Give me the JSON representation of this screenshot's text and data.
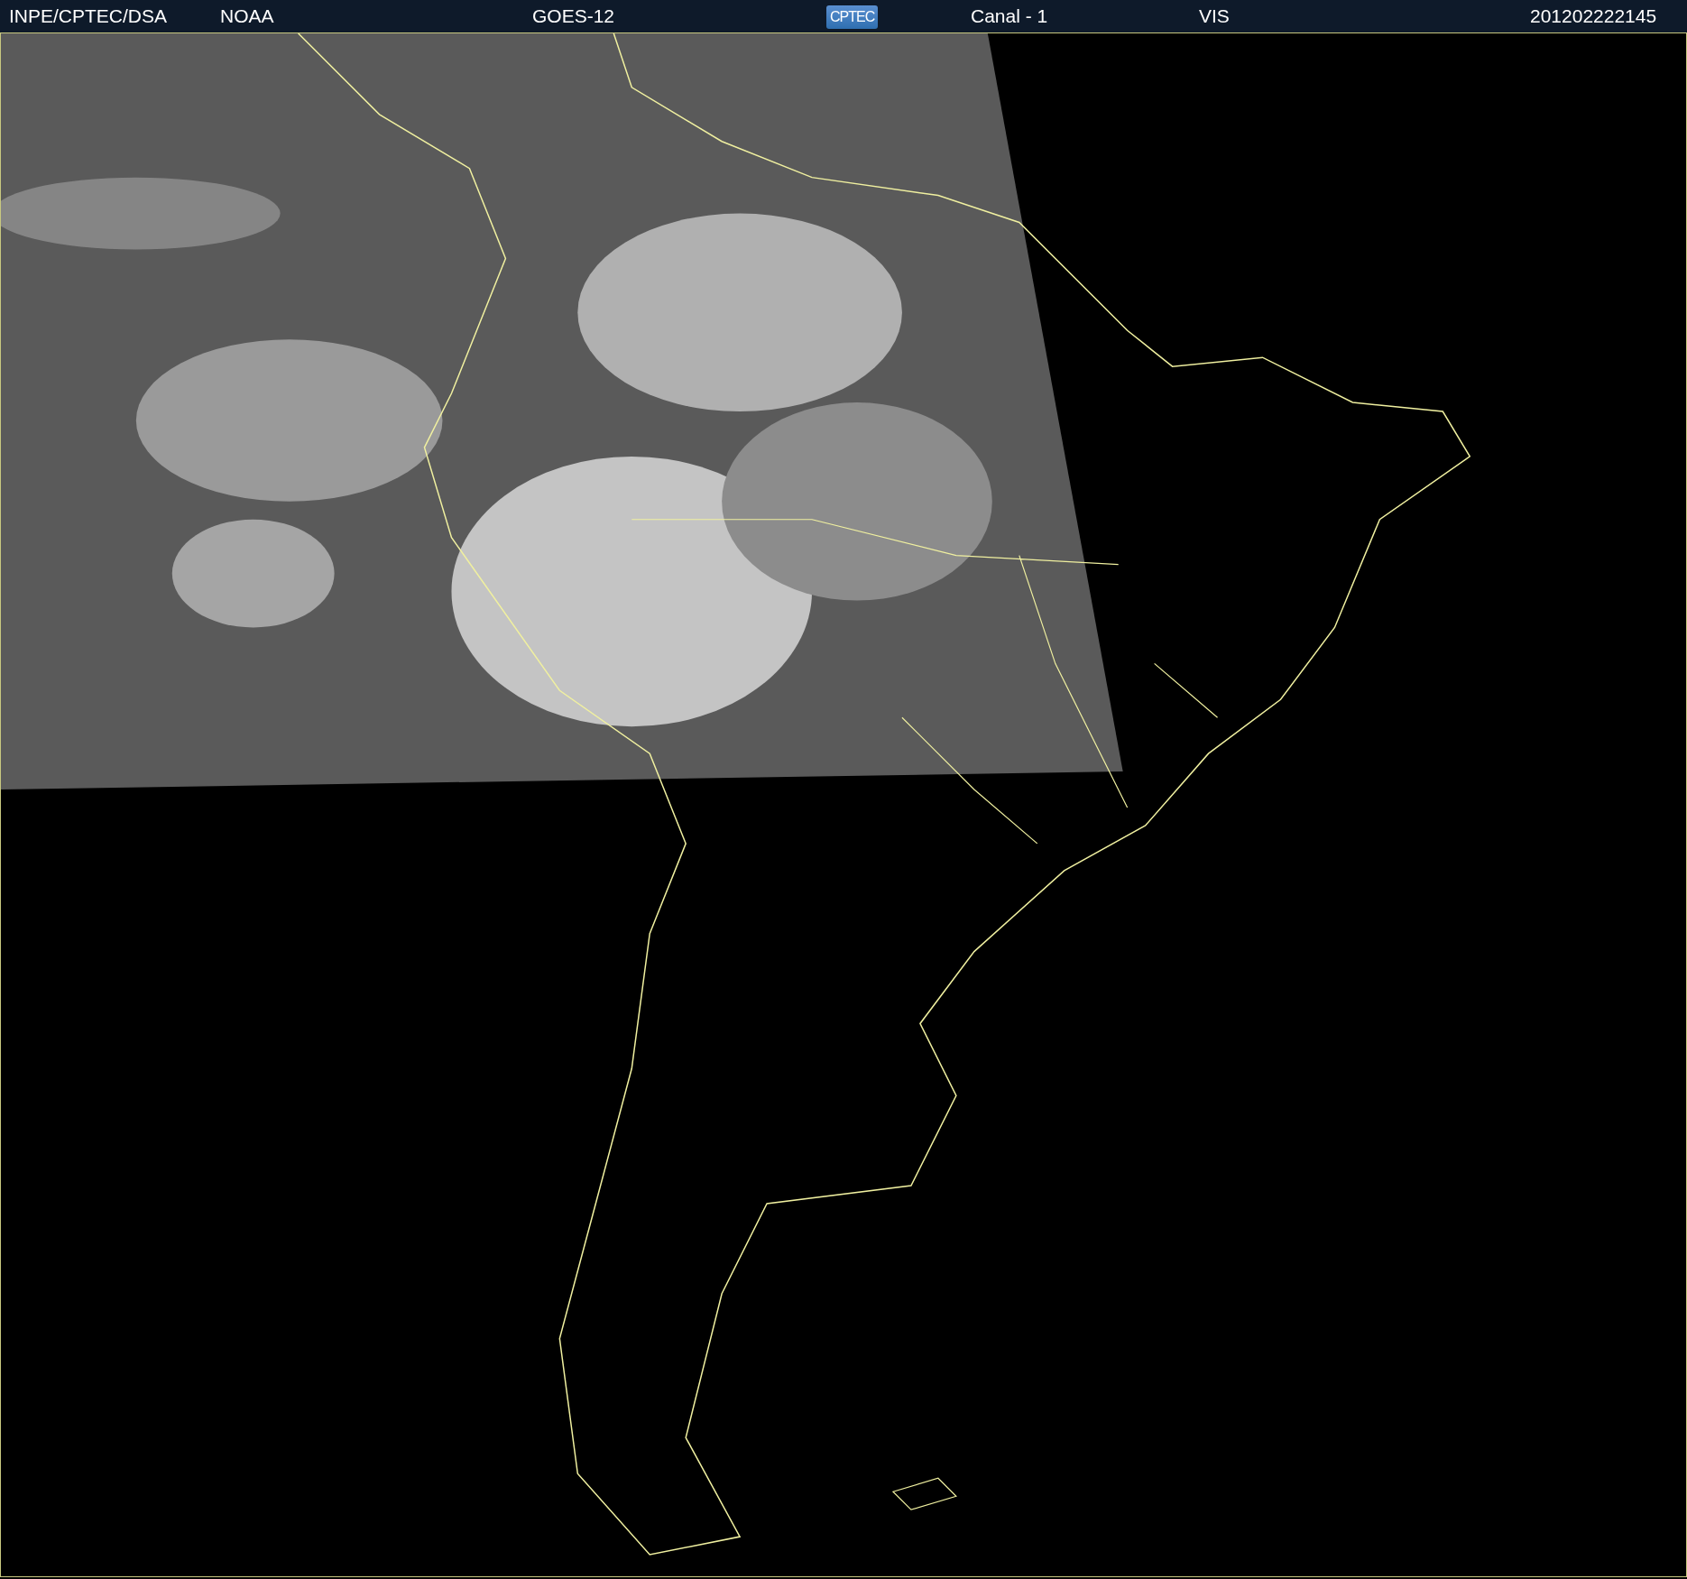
{
  "header": {
    "items": [
      {
        "kind": "text",
        "text": "INPE/CPTEC/DSA"
      },
      {
        "kind": "text",
        "text": "NOAA"
      },
      {
        "kind": "text",
        "text": "GOES-12"
      },
      {
        "kind": "logo",
        "text": "CPTEC"
      },
      {
        "kind": "text",
        "text": "Canal - 1"
      },
      {
        "kind": "text",
        "text": "VIS"
      },
      {
        "kind": "text",
        "text": "201202222145"
      }
    ]
  }
}
